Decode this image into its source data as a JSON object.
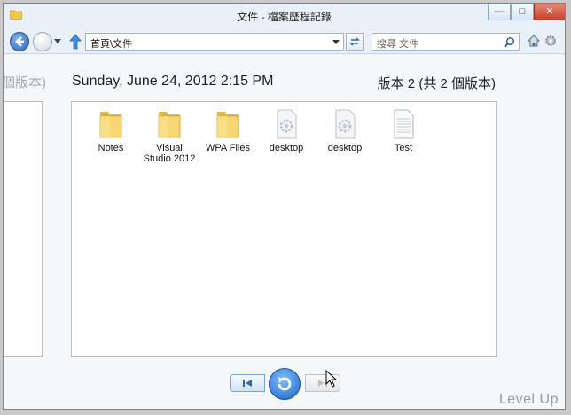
{
  "window": {
    "title": "文件 - 檔案歷程記錄",
    "minimize_glyph": "—",
    "maximize_glyph": "□",
    "close_glyph": "✕"
  },
  "navigation": {
    "address": "首頁\\文件",
    "search_placeholder": "搜尋 文件",
    "icons": [
      "back-icon",
      "forward-icon",
      "dropdown-icon",
      "up-icon",
      "refresh-icon",
      "search-icon",
      "home-icon",
      "gear-icon"
    ]
  },
  "content": {
    "previous_version_label": "個版本)",
    "date": "Sunday, June 24, 2012 2:15 PM",
    "version": "版本 2 (共 2 個版本)",
    "files": [
      {
        "name": "Notes",
        "icon": "folder-icon"
      },
      {
        "name": "Visual Studio 2012",
        "icon": "folder-icon"
      },
      {
        "name": "WPA Files",
        "icon": "folder-icon"
      },
      {
        "name": "desktop",
        "icon": "settings-file-icon"
      },
      {
        "name": "desktop",
        "icon": "settings-file-icon"
      },
      {
        "name": "Test",
        "icon": "text-file-icon"
      }
    ]
  },
  "playback": {
    "buttons": [
      "previous-version-button",
      "restore-button",
      "next-version-button"
    ]
  },
  "watermark": "Level Up",
  "colors": {
    "window_border": "#5c89c0",
    "accent_blue": "#1f63c6",
    "folder_yellow": "#f3cf62"
  }
}
